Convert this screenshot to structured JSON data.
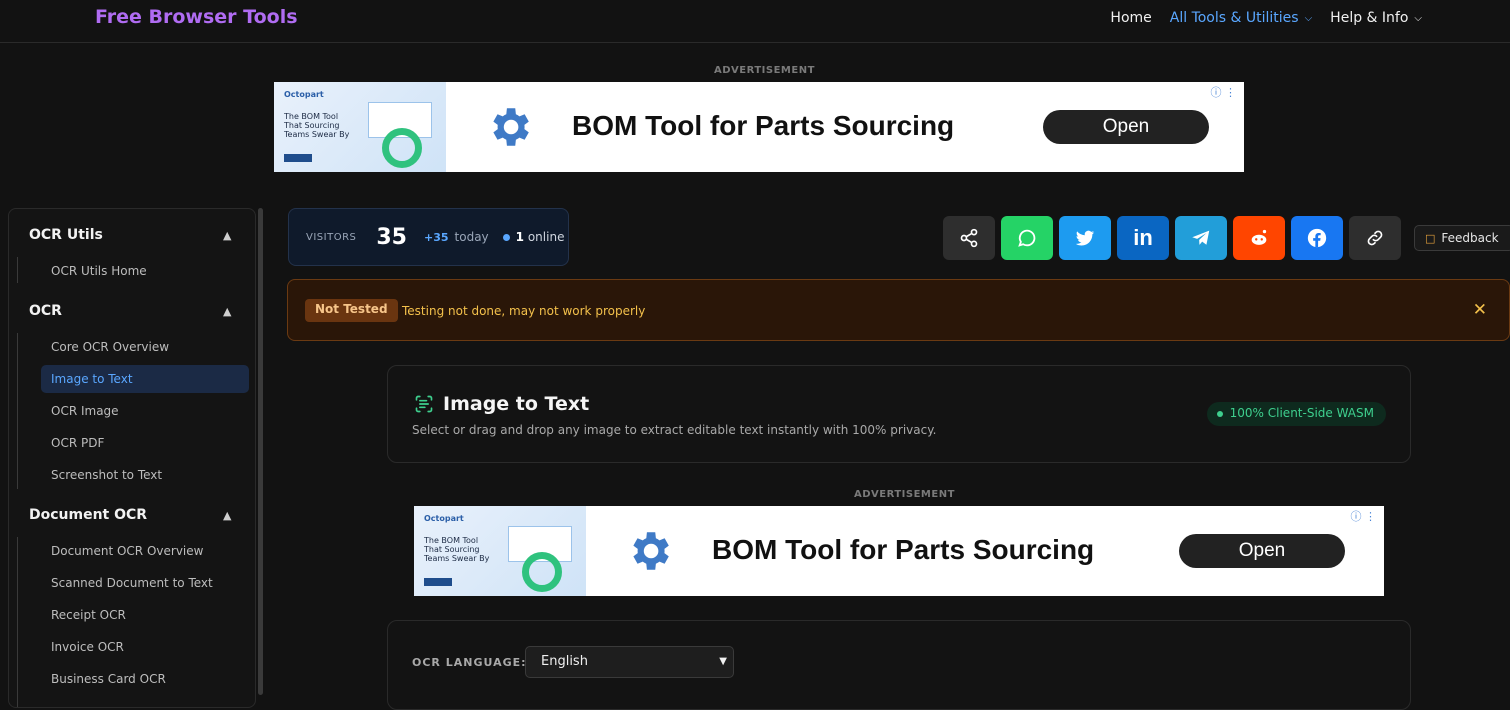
{
  "header": {
    "brand": "Free Browser Tools",
    "nav": {
      "home": "Home",
      "tools": "All Tools & Utilities",
      "help": "Help & Info"
    }
  },
  "ads": {
    "label": "ADVERTISEMENT",
    "brand": "Octopart",
    "thumb_text": "The BOM Tool That Sourcing Teams Swear By",
    "headline": "BOM Tool for Parts Sourcing",
    "cta": "Open"
  },
  "sidebar": {
    "groups": [
      {
        "title": "OCR Utils",
        "items": [
          "OCR Utils Home"
        ]
      },
      {
        "title": "OCR",
        "items": [
          "Core OCR Overview",
          "Image to Text",
          "OCR Image",
          "OCR PDF",
          "Screenshot to Text"
        ]
      },
      {
        "title": "Document OCR",
        "items": [
          "Document OCR Overview",
          "Scanned Document to Text",
          "Receipt OCR",
          "Invoice OCR",
          "Business Card OCR"
        ]
      }
    ],
    "active": "Image to Text"
  },
  "visitors": {
    "label": "VISITORS",
    "count": "35",
    "today_delta": "+35",
    "today_label": "today",
    "online_count": "1",
    "online_label": "online"
  },
  "share": {
    "buttons": [
      {
        "name": "share",
        "color": "#2e2e2e"
      },
      {
        "name": "whatsapp",
        "color": "#25d366"
      },
      {
        "name": "twitter",
        "color": "#1d9bf0"
      },
      {
        "name": "linkedin",
        "color": "#0a66c2"
      },
      {
        "name": "telegram",
        "color": "#229ed9"
      },
      {
        "name": "reddit",
        "color": "#ff4500"
      },
      {
        "name": "facebook",
        "color": "#1877f2"
      },
      {
        "name": "copy-link",
        "color": "#2e2e2e"
      }
    ]
  },
  "feedback": {
    "label": "Feedback"
  },
  "warning": {
    "badge": "Not Tested",
    "message": "Testing not done, may not work properly"
  },
  "tool": {
    "title": "Image to Text",
    "description": "Select or drag and drop any image to extract editable text instantly with 100% privacy.",
    "badge": "100% Client-Side WASM"
  },
  "ocr": {
    "language_label": "OCR LANGUAGE:",
    "language_value": "English"
  }
}
